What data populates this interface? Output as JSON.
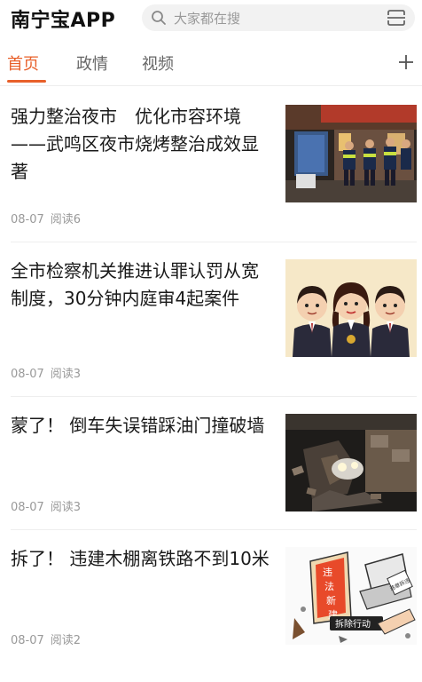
{
  "app": {
    "title": "南宁宝APP"
  },
  "search": {
    "placeholder": "大家都在搜",
    "icon": "search-icon",
    "scan_icon": "scan-icon"
  },
  "tabs": [
    {
      "label": "首页",
      "active": true
    },
    {
      "label": "政情",
      "active": false
    },
    {
      "label": "视频",
      "active": false
    }
  ],
  "accent_color": "#e8602a",
  "articles": [
    {
      "title": "强力整治夜市　优化市容环境——武鸣区夜市烧烤整治成效显著",
      "date": "08-07",
      "reads": "阅读6",
      "image": "police-patrol-night-street-photo"
    },
    {
      "title": "全市检察机关推进认罪认罚从宽制度，30分钟内庭审4起案件",
      "date": "08-07",
      "reads": "阅读3",
      "image": "three-prosecutors-cartoon"
    },
    {
      "title": "蒙了！ 倒车失误错踩油门撞破墙",
      "date": "08-07",
      "reads": "阅读3",
      "image": "car-crashed-through-wall-photo"
    },
    {
      "title": "拆了！ 违建木棚离铁路不到10米",
      "date": "08-07",
      "reads": "阅读2",
      "image": "demolish-illegal-building-cartoon"
    }
  ],
  "thumb_text": {
    "sign_chars": [
      "违",
      "法",
      "新",
      "建"
    ],
    "action_label": "拆除行动",
    "stamp_label": "违章拆违"
  }
}
